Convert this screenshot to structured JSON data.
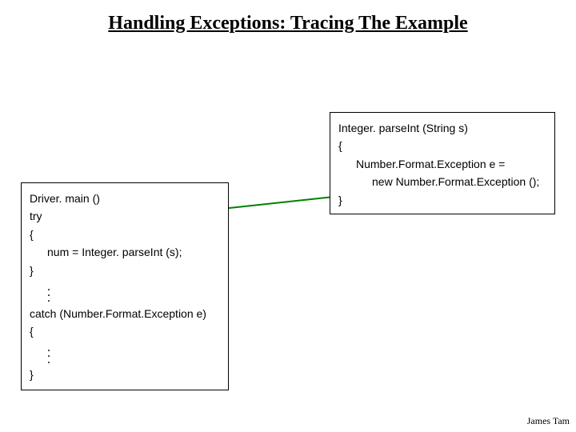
{
  "title": "Handling Exceptions: Tracing The Example",
  "right_box": {
    "header": "Integer. parseInt (String s)",
    "line1": "{",
    "line2": "Number.Format.Exception e =",
    "line3": "new Number.Format.Exception ();",
    "line4": "}"
  },
  "left_box": {
    "header": "Driver. main ()",
    "try": "try",
    "brace_open": "{",
    "assign": "num = Integer. parseInt (s);",
    "brace_close": "}",
    "catch": "catch (Number.Format.Exception e)",
    "brace_open2": "{",
    "brace_close2": "}"
  },
  "footer": "James Tam"
}
